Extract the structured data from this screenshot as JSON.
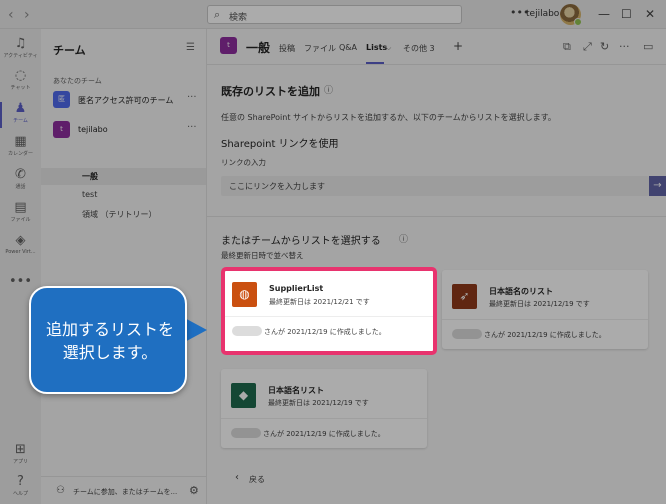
{
  "titlebar": {
    "search_placeholder": "検索",
    "more": "•••",
    "user": "tejilabo",
    "minimize": "—",
    "maximize": "☐",
    "close": "✕"
  },
  "rail": [
    {
      "label": "アクティビティ",
      "icon": "bell-icon"
    },
    {
      "label": "チャット",
      "icon": "chat-icon"
    },
    {
      "label": "チーム",
      "icon": "teams-icon"
    },
    {
      "label": "カレンダー",
      "icon": "calendar-icon"
    },
    {
      "label": "通話",
      "icon": "phone-icon"
    },
    {
      "label": "ファイル",
      "icon": "file-icon"
    },
    {
      "label": "Power Virt...",
      "icon": "bot-icon"
    },
    {
      "label": "•••",
      "icon": "more-icon"
    },
    {
      "label": "アプリ",
      "icon": "apps-icon"
    },
    {
      "label": "ヘルプ",
      "icon": "help-icon"
    }
  ],
  "teams_pane": {
    "title": "チーム",
    "section": "あなたのチーム",
    "teams": [
      {
        "initial": "匿",
        "name": "匿名アクセス許可のチーム",
        "color": "#4f6bed"
      },
      {
        "initial": "t",
        "name": "tejilabo",
        "color": "#8e2e9e"
      }
    ],
    "channels": [
      "一般",
      "test",
      "領域 （テリトリー）"
    ],
    "footer": "チームに参加、またはチームを..."
  },
  "header": {
    "avatar": "t",
    "channel": "一般",
    "tabs": [
      "投稿",
      "ファイル",
      "Q&A",
      "Lists",
      "その他 3"
    ],
    "active_tab": "Lists",
    "add_tab": "+"
  },
  "add_list": {
    "title": "既存のリストを追加",
    "description": "任意の SharePoint サイトからリストを追加するか、以下のチームからリストを選択します。",
    "sharepoint_heading": "Sharepoint リンクを使用",
    "link_label": "リンクの入力",
    "link_placeholder": "ここにリンクを入力します",
    "choose_heading": "またはチームからリストを選択する",
    "sort_label": "最終更新日時で並べ替え",
    "back": "戻る"
  },
  "lists": [
    {
      "title": "SupplierList",
      "updated": "最終更新日は 2021/12/21 です",
      "created": "さんが 2021/12/19 に作成しました。",
      "color": "#ca5010"
    },
    {
      "title": "日本語名のリスト",
      "updated": "最終更新日は 2021/12/19 です",
      "created": "さんが 2021/12/19 に作成しました。",
      "color": "#8f3a1a"
    },
    {
      "title": "日本語名リスト",
      "updated": "最終更新日は 2021/12/19 です",
      "created": "さんが 2021/12/19 に作成しました。",
      "color": "#1e6a4e"
    }
  ],
  "callout": {
    "text": "追加するリストを\n選択します。"
  },
  "colors": {
    "accent": "#5b5fc7",
    "highlight": "#e8336e",
    "callout": "#1f6fc1"
  }
}
